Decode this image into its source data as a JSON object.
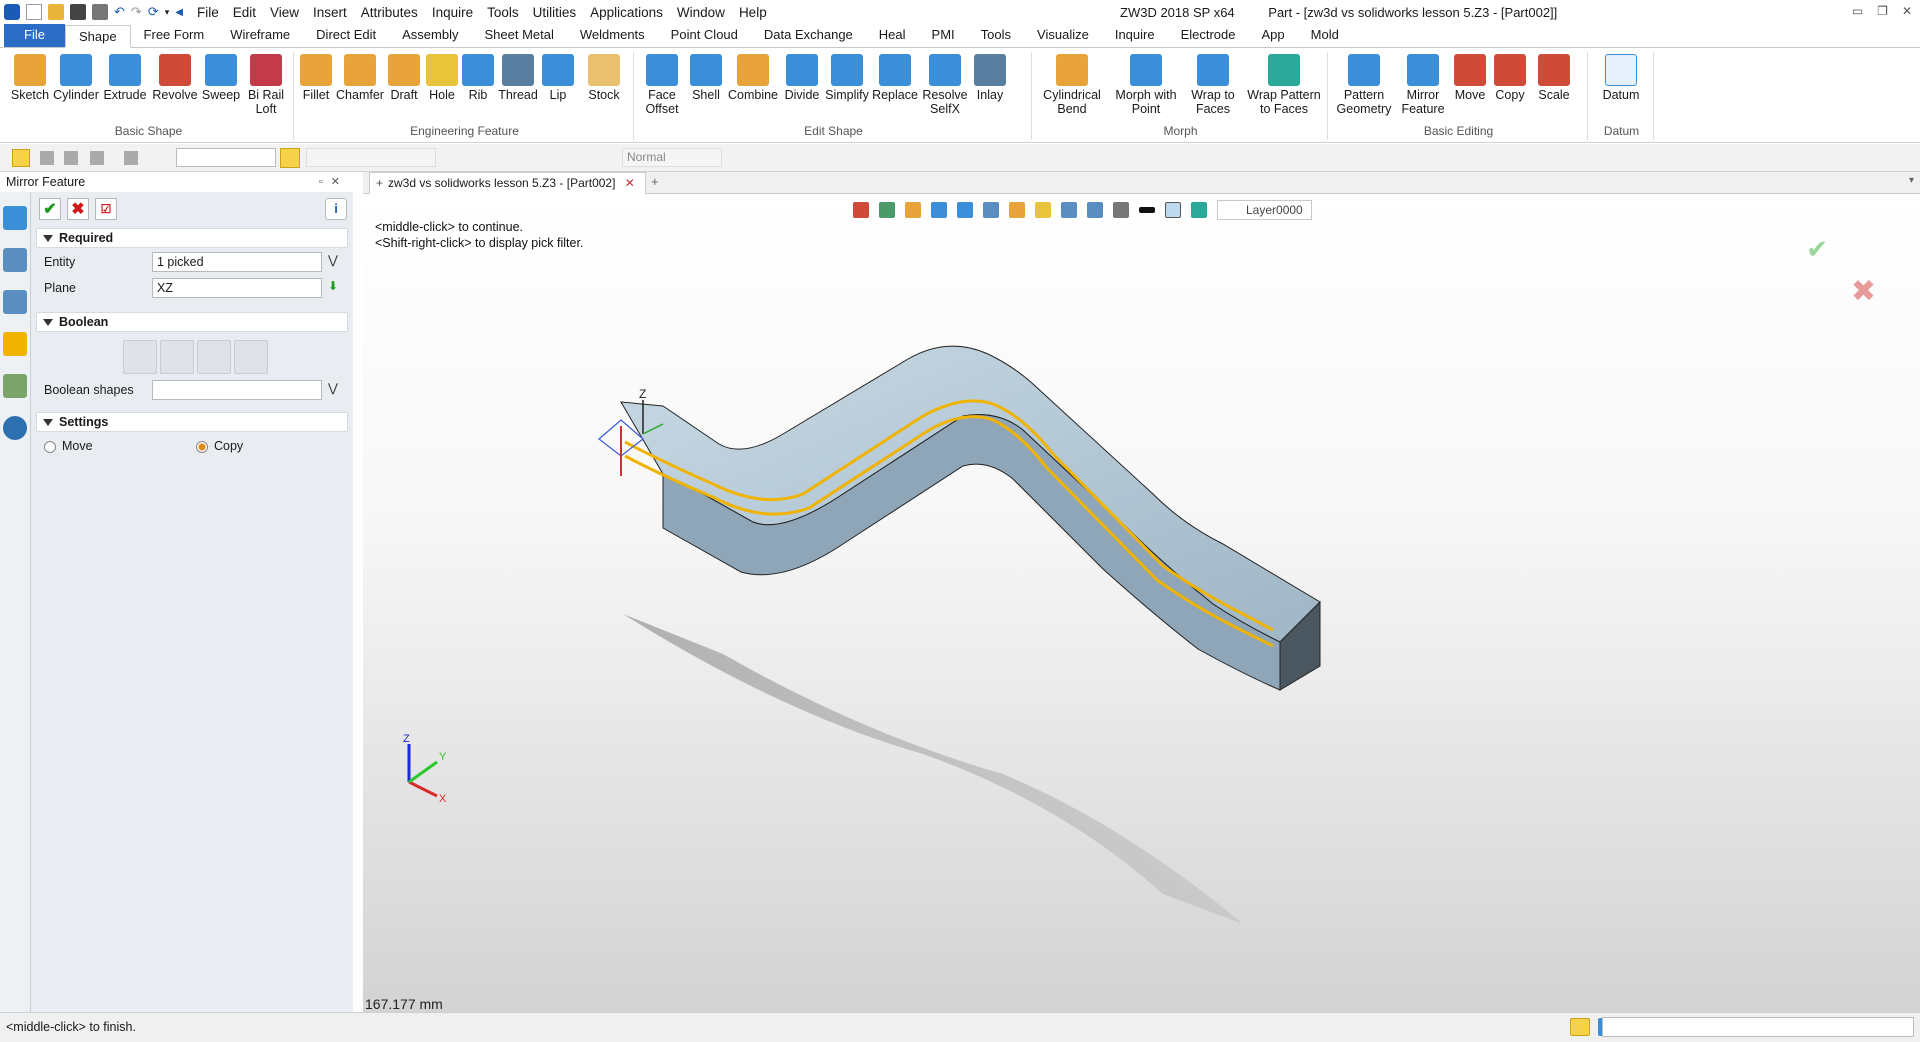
{
  "app": {
    "menu": [
      "File",
      "Edit",
      "View",
      "Insert",
      "Attributes",
      "Inquire",
      "Tools",
      "Utilities",
      "Applications",
      "Window",
      "Help"
    ],
    "title": "ZW3D 2018 SP x64",
    "doc_title": "Part - [zw3d vs solidworks lesson 5.Z3 - [Part002]]"
  },
  "tabs": [
    "File",
    "Shape",
    "Free Form",
    "Wireframe",
    "Direct Edit",
    "Assembly",
    "Sheet Metal",
    "Weldments",
    "Point Cloud",
    "Data Exchange",
    "Heal",
    "PMI",
    "Tools",
    "Visualize",
    "Inquire",
    "Electrode",
    "App",
    "Mold"
  ],
  "ribbon": {
    "groups": [
      {
        "label": "Basic Shape",
        "buttons": [
          "Sketch",
          "Cylinder",
          "Extrude",
          "Revolve",
          "Sweep",
          "Bi Rail Loft"
        ]
      },
      {
        "label": "Engineering Feature",
        "buttons": [
          "Fillet",
          "Chamfer",
          "Draft",
          "Hole",
          "Rib",
          "Thread",
          "Lip",
          "Stock"
        ]
      },
      {
        "label": "Edit Shape",
        "buttons": [
          "Face Offset",
          "Shell",
          "Combine",
          "Divide",
          "Simplify",
          "Replace",
          "Resolve SelfX",
          "Inlay"
        ]
      },
      {
        "label": "Morph",
        "buttons": [
          "Cylindrical Bend",
          "Morph with Point",
          "Wrap to Faces",
          "Wrap Pattern to Faces"
        ]
      },
      {
        "label": "Basic Editing",
        "buttons": [
          "Pattern Geometry",
          "Mirror Feature",
          "Move",
          "Copy",
          "Scale"
        ]
      },
      {
        "label": "Datum",
        "buttons": [
          "Datum"
        ]
      }
    ]
  },
  "toolbar2": {
    "render_mode": "Normal"
  },
  "panel": {
    "title": "Mirror Feature",
    "required_label": "Required",
    "entity_label": "Entity",
    "entity_value": "1 picked",
    "plane_label": "Plane",
    "plane_value": "XZ",
    "boolean_label": "Boolean",
    "boolean_shapes_label": "Boolean shapes",
    "boolean_shapes_value": "",
    "settings_label": "Settings",
    "move_label": "Move",
    "copy_label": "Copy"
  },
  "document_tab": "zw3d vs solidworks lesson 5.Z3 - [Part002]",
  "viewport": {
    "hint1": "<middle-click> to continue.",
    "hint2": "<Shift-right-click> to display pick filter.",
    "layer": "Layer0000",
    "dimension": "167.177 mm",
    "axis_x": "X",
    "axis_y": "Y",
    "axis_z": "Z"
  },
  "status": {
    "message": "<middle-click> to finish."
  },
  "colors": {
    "accent": "#2b6cc4",
    "part_face": "#b8ccd8",
    "highlight": "#f0b400"
  }
}
